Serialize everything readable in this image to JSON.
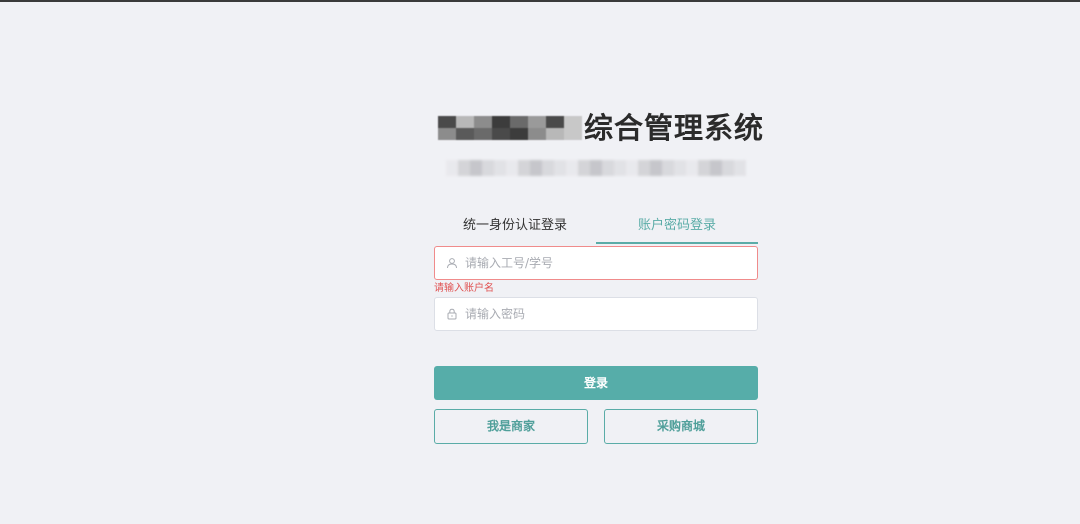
{
  "header": {
    "title_suffix": "综合管理系统"
  },
  "tabs": [
    {
      "label": "统一身份认证登录",
      "active": false
    },
    {
      "label": "账户密码登录",
      "active": true
    }
  ],
  "form": {
    "username": {
      "placeholder": "请输入工号/学号",
      "value": "",
      "icon": "user-icon"
    },
    "username_error": "请输入账户名",
    "password": {
      "placeholder": "请输入密码",
      "value": "",
      "icon": "lock-icon"
    }
  },
  "buttons": {
    "login": "登录",
    "merchant": "我是商家",
    "mall": "采购商城"
  },
  "colors": {
    "accent": "#56ada9",
    "error": "#e05353",
    "background": "#f0f1f5"
  }
}
